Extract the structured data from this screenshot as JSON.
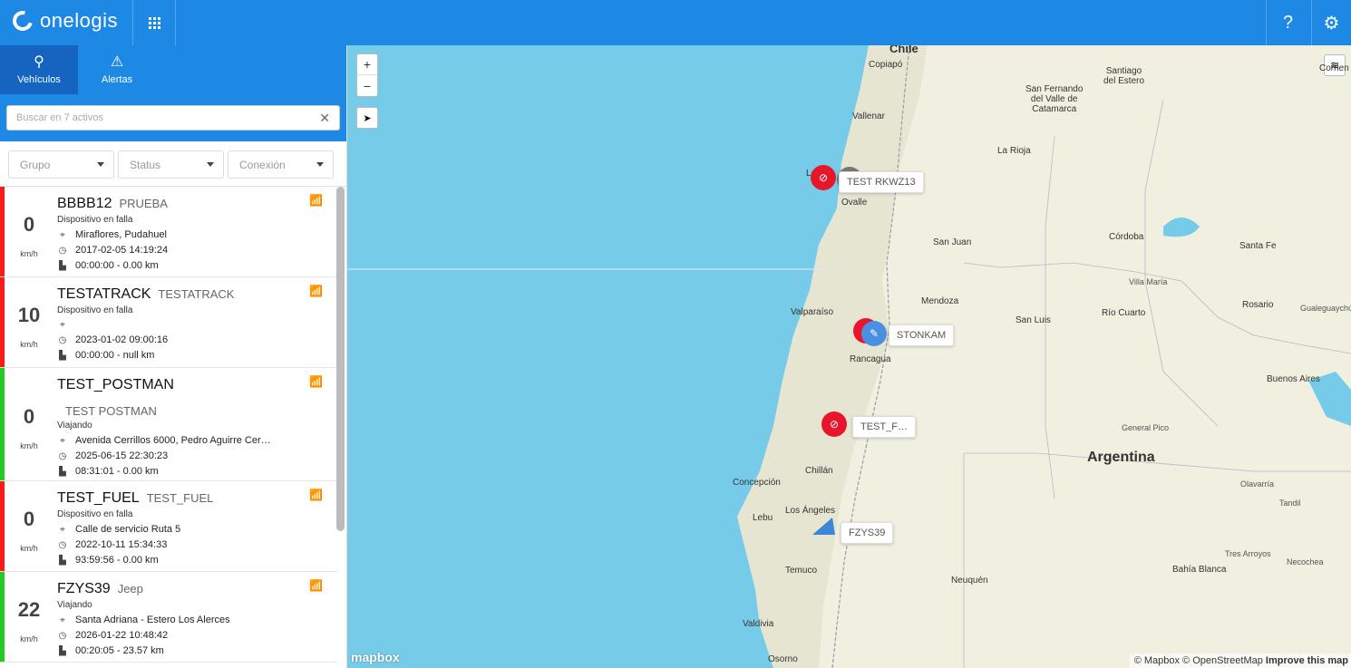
{
  "app": {
    "brand": "onelogis",
    "help_label": "?",
    "settings_icon": "gear-icon"
  },
  "sidebar": {
    "tabs": [
      {
        "label": "Vehículos",
        "icon": "map-pin-icon",
        "active": true
      },
      {
        "label": "Alertas",
        "icon": "warning-icon",
        "active": false
      }
    ],
    "search": {
      "placeholder": "Buscar en 7 activos",
      "value": ""
    },
    "filters": [
      {
        "label": "Grupo"
      },
      {
        "label": "Status"
      },
      {
        "label": "Conexión"
      }
    ],
    "vehicles": [
      {
        "name": "BBBB12",
        "alias": "PRUEBA",
        "speed": "0",
        "unit": "km/h",
        "status": "Dispositivo en falla",
        "location": "Miraflores, Pudahuel",
        "datetime": "2017-02-05 14:19:24",
        "odometer": "00:00:00 - 0.00 km",
        "status_color": "#ff1a1a",
        "connection": "no-signal"
      },
      {
        "name": "TESTATRACK",
        "alias": "TESTATRACK",
        "speed": "10",
        "unit": "km/h",
        "status": "Dispositivo en falla",
        "location": "",
        "datetime": "2023-01-02 09:00:16",
        "odometer": "00:00:00 - null km",
        "status_color": "#ff1a1a",
        "connection": "no-signal"
      },
      {
        "name": "TEST_POSTMAN",
        "alias": "TEST POSTMAN",
        "speed": "0",
        "unit": "km/h",
        "status": "Viajando",
        "location": "Avenida Cerrillos 6000, Pedro Aguirre Cer…",
        "datetime": "2025-06-15 22:30:23",
        "odometer": "08:31:01 - 0.00 km",
        "status_color": "#22cc22",
        "connection": "no-signal"
      },
      {
        "name": "TEST_FUEL",
        "alias": "TEST_FUEL",
        "speed": "0",
        "unit": "km/h",
        "status": "Dispositivo en falla",
        "location": "Calle de servicio Ruta 5",
        "datetime": "2022-10-11 15:34:33",
        "odometer": "93:59:56 - 0.00 km",
        "status_color": "#ff1a1a",
        "connection": "no-signal"
      },
      {
        "name": "FZYS39",
        "alias": "Jeep",
        "speed": "22",
        "unit": "km/h",
        "status": "Viajando",
        "location": "Santa Adriana - Estero Los Alerces",
        "datetime": "2026-01-22 10:48:42",
        "odometer": "00:20:05 - 23.57 km",
        "status_color": "#22cc22",
        "connection": "weak-signal"
      }
    ]
  },
  "map": {
    "zoom_in": "+",
    "zoom_out": "−",
    "labels": {
      "chile": "Chile",
      "copiapo": "Copiapó",
      "vallenar": "Vallenar",
      "ovalle": "Ovalle",
      "la_serena": "La",
      "valparaiso": "Valparaíso",
      "rancagua": "Rancagua",
      "concepcion": "Concepción",
      "chillan": "Chillán",
      "lebu": "Lebu",
      "los_angeles": "Los Ángeles",
      "temuco": "Temuco",
      "valdivia": "Valdivia",
      "osorno": "Osorno",
      "santiago_del_estero": "Santiago\ndel Estero",
      "san_fernando": "San Fernando\ndel Valle de\nCatamarca",
      "la_rioja": "La Rioja",
      "san_juan": "San Juan",
      "cordoba": "Córdoba",
      "santa_fe": "Santa Fe",
      "corrientes": "Corrien",
      "villa_maria": "Villa María",
      "rosario": "Rosario",
      "mendoza": "Mendoza",
      "san_luis": "San Luis",
      "rio_cuarto": "Río Cuarto",
      "gualeguaychu": "Gualeguaychú",
      "buenos_aires": "Buenos Aires",
      "general_pico": "General Pico",
      "argentina": "Argentina",
      "olavarria": "Olavarría",
      "tandil": "Tandil",
      "tres_arroyos": "Tres Arroyos",
      "necochea": "Necochea",
      "bahia_blanca": "Bahía Blanca",
      "neuquen": "Neuquén"
    },
    "tags": [
      {
        "label": "TEST RKWZ13"
      },
      {
        "label": "STONKAM"
      },
      {
        "label": "TEST_F…"
      },
      {
        "label": "FZYS39"
      }
    ],
    "logo": "mapbox",
    "attribution_prefix": "© Mapbox © OpenStreetMap",
    "attribution_link": "Improve this map"
  }
}
